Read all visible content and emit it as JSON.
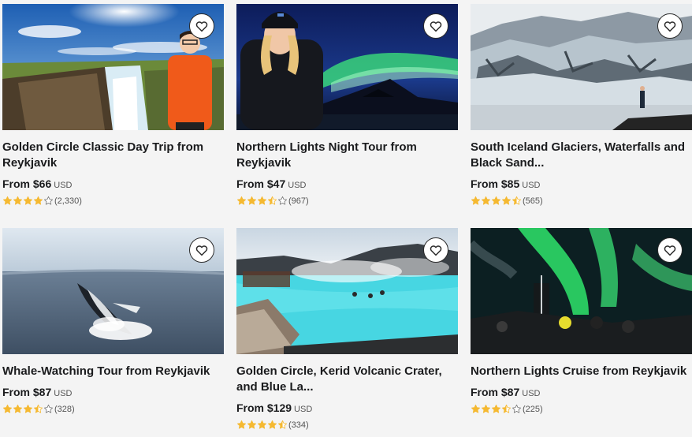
{
  "cards": [
    {
      "title": "Golden Circle Classic Day Trip from Reykjavik",
      "price_prefix": "From",
      "price": "$66",
      "currency": "USD",
      "rating": 4.0,
      "reviews": "(2,330)"
    },
    {
      "title": "Northern Lights Night Tour from Reykjavik",
      "price_prefix": "From",
      "price": "$47",
      "currency": "USD",
      "rating": 3.5,
      "reviews": "(967)"
    },
    {
      "title": "South Iceland Glaciers, Waterfalls and Black Sand...",
      "price_prefix": "From",
      "price": "$85",
      "currency": "USD",
      "rating": 4.5,
      "reviews": "(565)"
    },
    {
      "title": "Whale-Watching Tour from Reykjavik",
      "price_prefix": "From",
      "price": "$87",
      "currency": "USD",
      "rating": 3.5,
      "reviews": "(328)"
    },
    {
      "title": "Golden Circle, Kerid Volcanic Crater, and Blue La...",
      "price_prefix": "From",
      "price": "$129",
      "currency": "USD",
      "rating": 4.5,
      "reviews": "(334)"
    },
    {
      "title": "Northern Lights Cruise from Reykjavik",
      "price_prefix": "From",
      "price": "$87",
      "currency": "USD",
      "rating": 3.5,
      "reviews": "(225)"
    }
  ],
  "icons": {
    "wishlist": "heart-icon",
    "rating": "star-icon"
  },
  "colors": {
    "star": "#f5b931",
    "star_empty": "#ffffff",
    "text": "#1a1b1d",
    "background": "#f4f4f4"
  }
}
